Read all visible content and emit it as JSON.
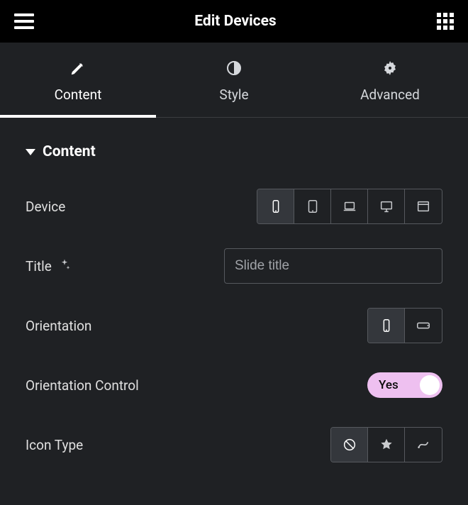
{
  "topbar": {
    "title": "Edit Devices"
  },
  "tabs": {
    "content": "Content",
    "style": "Style",
    "advanced": "Advanced",
    "active": "content"
  },
  "section": {
    "title": "Content"
  },
  "fields": {
    "device": {
      "label": "Device"
    },
    "title": {
      "label": "Title",
      "value": "Slide title"
    },
    "orientation": {
      "label": "Orientation"
    },
    "orientation_control": {
      "label": "Orientation Control",
      "value": "Yes"
    },
    "icon_type": {
      "label": "Icon Type"
    }
  }
}
